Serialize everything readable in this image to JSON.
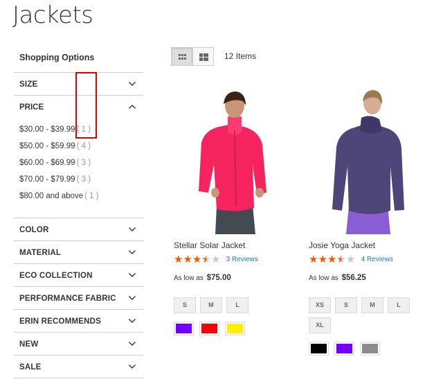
{
  "page": {
    "title": "Jackets"
  },
  "sidebar": {
    "title": "Shopping Options",
    "size_label": "SIZE",
    "price": {
      "label": "PRICE",
      "items": [
        {
          "range": "$30.00 - $39.99",
          "count": "( 1 )"
        },
        {
          "range": "$50.00 - $59.99",
          "count": "( 4 )"
        },
        {
          "range": "$60.00 - $69.99",
          "count": "( 3 )"
        },
        {
          "range": "$70.00 - $79.99",
          "count": "( 3 )"
        },
        {
          "range": "$80.00 and above",
          "count": "( 1 )"
        }
      ]
    },
    "filters": [
      "COLOR",
      "MATERIAL",
      "ECO COLLECTION",
      "PERFORMANCE FABRIC",
      "ERIN RECOMMENDS",
      "NEW",
      "SALE"
    ]
  },
  "toolbar": {
    "items_count": "12 Items",
    "view_mode": "grid"
  },
  "products": [
    {
      "name": "Stellar Solar Jacket",
      "rating_stars": 3.5,
      "reviews": "3  Reviews",
      "price_prefix": "As low as",
      "price": "$75.00",
      "sizes": [
        "S",
        "M",
        "L"
      ],
      "swatch_colors": [
        "#7300ff",
        "#ff0000",
        "#ffee00"
      ]
    },
    {
      "name": "Josie Yoga Jacket",
      "rating_stars": 3.5,
      "reviews": "4  Reviews",
      "price_prefix": "As low as",
      "price": "$56.25",
      "sizes": [
        "XS",
        "S",
        "M",
        "L",
        "XL"
      ],
      "swatch_colors": [
        "#000000",
        "#7300ff",
        "#8c8c8c"
      ]
    }
  ],
  "colors": {
    "star": "#ff5501",
    "link": "#1979c3",
    "highlight": "#e00000"
  }
}
